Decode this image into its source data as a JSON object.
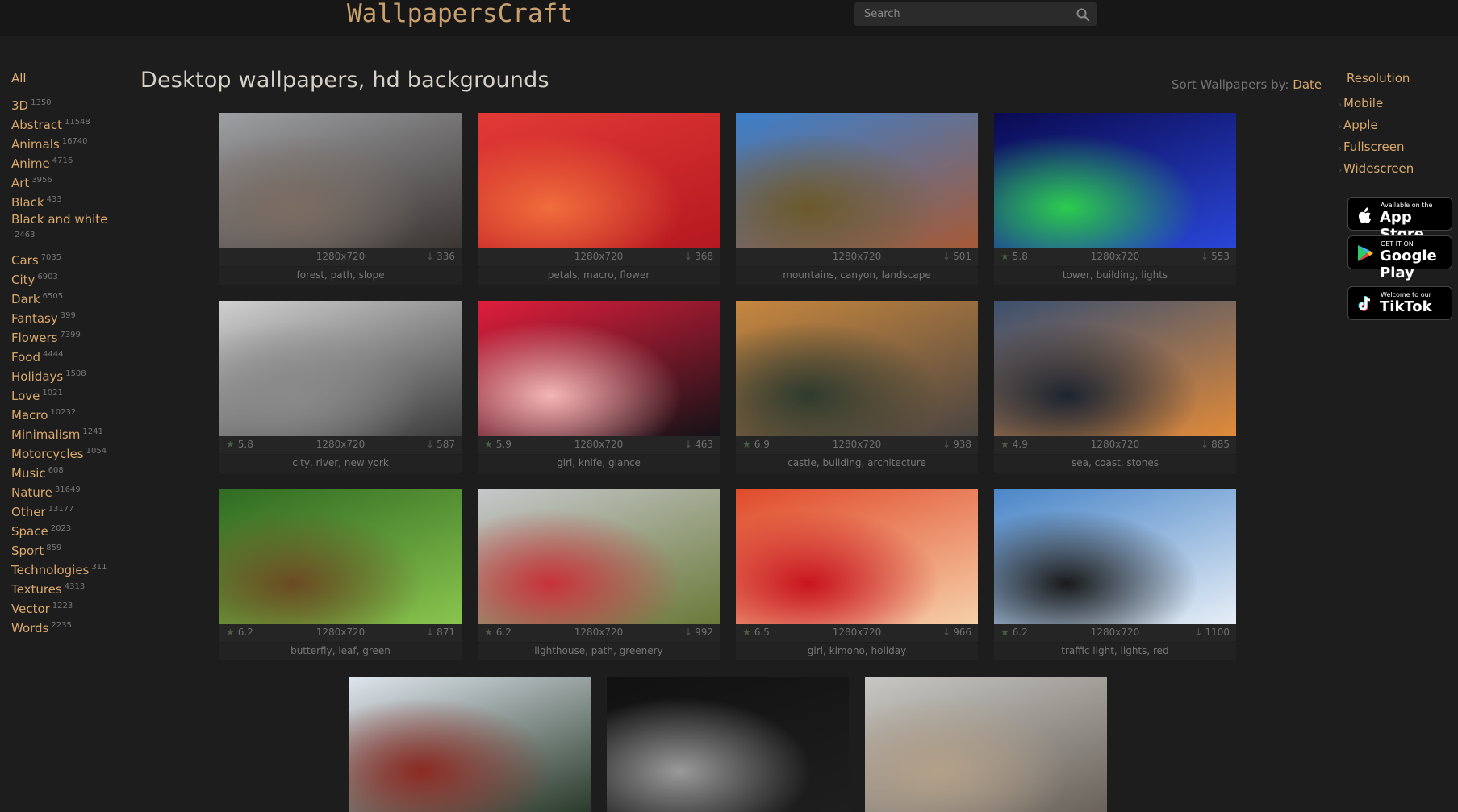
{
  "header": {
    "logo": "WallpapersCraft",
    "search_placeholder": "Search"
  },
  "page": {
    "title": "Desktop wallpapers, hd backgrounds",
    "sort_label": "Sort Wallpapers by:",
    "sort_value": "Date"
  },
  "categories": {
    "all": "All",
    "items": [
      {
        "name": "3D",
        "count": "1350"
      },
      {
        "name": "Abstract",
        "count": "11548"
      },
      {
        "name": "Animals",
        "count": "16740"
      },
      {
        "name": "Anime",
        "count": "4716"
      },
      {
        "name": "Art",
        "count": "3956"
      },
      {
        "name": "Black",
        "count": "433"
      },
      {
        "name": "Black and white",
        "count": "2463"
      },
      {
        "name": "Cars",
        "count": "7035"
      },
      {
        "name": "City",
        "count": "6903"
      },
      {
        "name": "Dark",
        "count": "6505"
      },
      {
        "name": "Fantasy",
        "count": "399"
      },
      {
        "name": "Flowers",
        "count": "7399"
      },
      {
        "name": "Food",
        "count": "4444"
      },
      {
        "name": "Holidays",
        "count": "1508"
      },
      {
        "name": "Love",
        "count": "1021"
      },
      {
        "name": "Macro",
        "count": "10232"
      },
      {
        "name": "Minimalism",
        "count": "1241"
      },
      {
        "name": "Motorcycles",
        "count": "1054"
      },
      {
        "name": "Music",
        "count": "608"
      },
      {
        "name": "Nature",
        "count": "31649"
      },
      {
        "name": "Other",
        "count": "13177"
      },
      {
        "name": "Space",
        "count": "2023"
      },
      {
        "name": "Sport",
        "count": "859"
      },
      {
        "name": "Technologies",
        "count": "311"
      },
      {
        "name": "Textures",
        "count": "4313"
      },
      {
        "name": "Vector",
        "count": "1223"
      },
      {
        "name": "Words",
        "count": "2235"
      }
    ]
  },
  "resolution": {
    "heading": "Resolution",
    "items": [
      "Mobile",
      "Apple",
      "Fullscreen",
      "Widescreen"
    ]
  },
  "stores": {
    "appstore": {
      "small": "Available on the",
      "big": "App Store"
    },
    "googleplay": {
      "small": "GET IT ON",
      "big": "Google Play"
    },
    "tiktok": {
      "small": "Welcome to our",
      "big": "TikTok"
    }
  },
  "wallpapers": [
    {
      "rating": "",
      "res": "1280x720",
      "downloads": "336",
      "tags": "forest, path, slope",
      "colors": [
        "#9ea0a3",
        "#3b3533",
        "#7c6d63"
      ]
    },
    {
      "rating": "",
      "res": "1280x720",
      "downloads": "368",
      "tags": "petals, macro, flower",
      "colors": [
        "#e23a36",
        "#b51820",
        "#f06d3c"
      ]
    },
    {
      "rating": "",
      "res": "1280x720",
      "downloads": "501",
      "tags": "mountains, canyon, landscape",
      "colors": [
        "#3b7fcb",
        "#a65a36",
        "#6b5a2c"
      ]
    },
    {
      "rating": "5.8",
      "res": "1280x720",
      "downloads": "553",
      "tags": "tower, building, lights",
      "colors": [
        "#0a0a50",
        "#2a46d8",
        "#2ccc4e"
      ]
    },
    {
      "rating": "5.8",
      "res": "1280x720",
      "downloads": "587",
      "tags": "city, river, new york",
      "colors": [
        "#d0d0d0",
        "#3c3c3c",
        "#8a8a8a"
      ]
    },
    {
      "rating": "5.9",
      "res": "1280x720",
      "downloads": "463",
      "tags": "girl, knife, glance",
      "colors": [
        "#e01e3c",
        "#141216",
        "#f4b6b6"
      ]
    },
    {
      "rating": "6.9",
      "res": "1280x720",
      "downloads": "938",
      "tags": "castle, building, architecture",
      "colors": [
        "#c7873f",
        "#4a4440",
        "#2f3b2e"
      ]
    },
    {
      "rating": "4.9",
      "res": "1280x720",
      "downloads": "885",
      "tags": "sea, coast, stones",
      "colors": [
        "#3b5070",
        "#e08a3a",
        "#1c2430"
      ]
    },
    {
      "rating": "6.2",
      "res": "1280x720",
      "downloads": "871",
      "tags": "butterfly, leaf, green",
      "colors": [
        "#2f6b22",
        "#8ac44e",
        "#6b4a22"
      ]
    },
    {
      "rating": "6.2",
      "res": "1280x720",
      "downloads": "992",
      "tags": "lighthouse, path, greenery",
      "colors": [
        "#c6c8cb",
        "#6c7a3a",
        "#c8323a"
      ]
    },
    {
      "rating": "6.5",
      "res": "1280x720",
      "downloads": "966",
      "tags": "girl, kimono, holiday",
      "colors": [
        "#e04a2a",
        "#f6d0a8",
        "#c8141e"
      ]
    },
    {
      "rating": "6.2",
      "res": "1280x720",
      "downloads": "1100",
      "tags": "traffic light, lights, red",
      "colors": [
        "#4a86c8",
        "#e6eef6",
        "#1a1a1a"
      ]
    },
    {
      "rating": "",
      "res": "",
      "downloads": "",
      "tags": "",
      "colors": [
        "#dfe6ee",
        "#2a3a2a",
        "#8b2a22"
      ]
    },
    {
      "rating": "",
      "res": "",
      "downloads": "",
      "tags": "",
      "colors": [
        "#111111",
        "#1e1e1e",
        "#9a9a9a"
      ]
    },
    {
      "rating": "",
      "res": "",
      "downloads": "",
      "tags": "",
      "colors": [
        "#c8c8c4",
        "#6a625a",
        "#b4a088"
      ]
    }
  ]
}
